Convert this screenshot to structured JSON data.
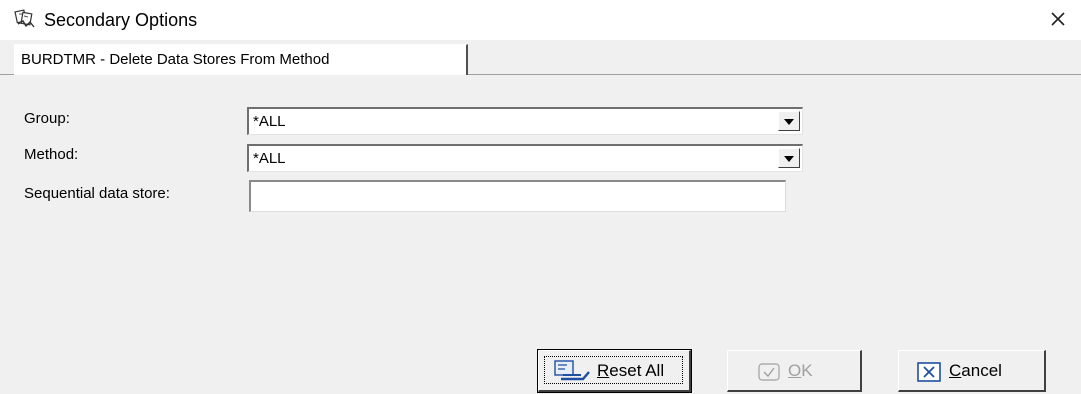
{
  "window": {
    "title": "Secondary Options",
    "app_icon": "stacked-cards-icon",
    "close_icon": "close-icon"
  },
  "tabs": [
    {
      "label": "BURDTMR - Delete Data Stores From Method",
      "selected": true
    }
  ],
  "form": {
    "group": {
      "label": "Group:",
      "value": "*ALL"
    },
    "method": {
      "label": "Method:",
      "value": "*ALL"
    },
    "sequential": {
      "label": "Sequential data store:",
      "value": ""
    }
  },
  "buttons": {
    "reset": {
      "label": "Reset All",
      "mnemonic": "R",
      "icon": "reset-icon",
      "enabled": true
    },
    "ok": {
      "label": "OK",
      "mnemonic": "O",
      "icon": "ok-check-icon",
      "enabled": false
    },
    "cancel": {
      "label": "Cancel",
      "mnemonic": "C",
      "icon": "cancel-x-icon",
      "enabled": true
    }
  },
  "colors": {
    "face": "#f0f0f0",
    "disabled_text": "#a0a0a0",
    "cancel_icon": "#1f4fa0"
  }
}
